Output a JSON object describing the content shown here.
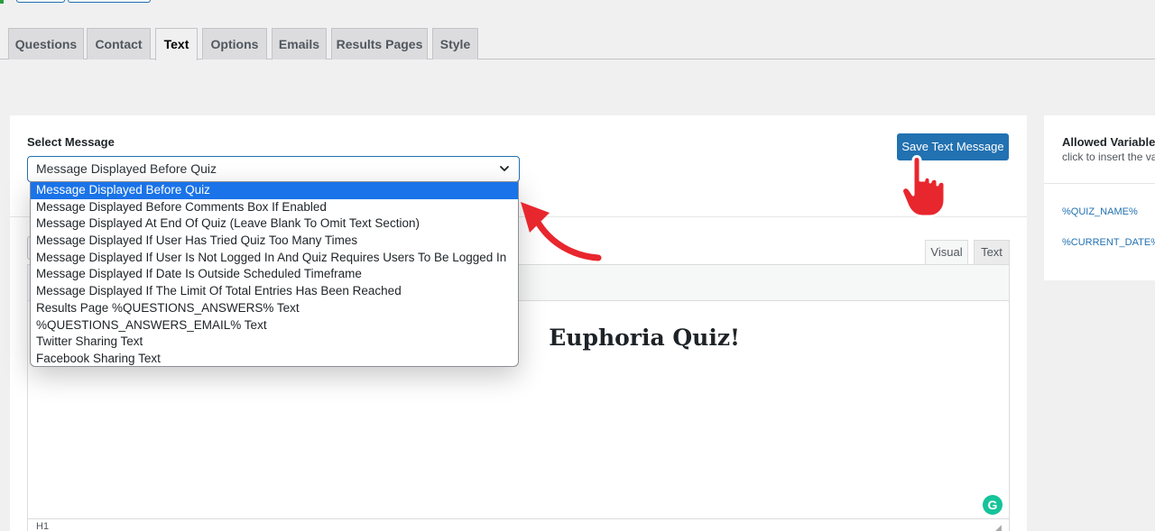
{
  "tabs": [
    {
      "label": "Questions",
      "active": false
    },
    {
      "label": "Contact",
      "active": false
    },
    {
      "label": "Text",
      "active": true
    },
    {
      "label": "Options",
      "active": false
    },
    {
      "label": "Emails",
      "active": false
    },
    {
      "label": "Results Pages",
      "active": false
    },
    {
      "label": "Style",
      "active": false
    }
  ],
  "select_message": {
    "label": "Select Message",
    "current_value": "Message Displayed Before Quiz",
    "options": [
      "Message Displayed Before Quiz",
      "Message Displayed Before Comments Box If Enabled",
      "Message Displayed At End Of Quiz (Leave Blank To Omit Text Section)",
      "Message Displayed If User Has Tried Quiz Too Many Times",
      "Message Displayed If User Is Not Logged In And Quiz Requires Users To Be Logged In",
      "Message Displayed If Date Is Outside Scheduled Timeframe",
      "Message Displayed If The Limit Of Total Entries Has Been Reached",
      "Results Page %QUESTIONS_ANSWERS% Text",
      "%QUESTIONS_ANSWERS_EMAIL% Text",
      "Twitter Sharing Text",
      "Facebook Sharing Text"
    ],
    "selected_index": 0
  },
  "save_button": {
    "label": "Save Text Message"
  },
  "editor": {
    "tab_visual": "Visual",
    "tab_text": "Text",
    "content_heading": "Euphoria Quiz!",
    "status_path": "H1"
  },
  "allowed_variables": {
    "title": "Allowed Variables",
    "subtitle": "click to insert the variable",
    "items": [
      "%QUIZ_NAME%",
      "%CURRENT_DATE%"
    ]
  },
  "colors": {
    "accent": "#2271b1",
    "selected_option": "#1a73e8",
    "annotation_red": "#e8262e",
    "grammarly": "#15c39a"
  },
  "icons": {
    "select_chevron": "chevron-down-icon",
    "grammarly": "grammarly-icon",
    "annotation_arrow": "red-arrow-icon",
    "annotation_hand": "pointing-hand-icon"
  }
}
